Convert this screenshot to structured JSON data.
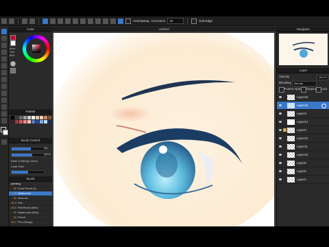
{
  "toolbar": {
    "antialiasing_label": "AntiAliasing",
    "correction_label": "Correction",
    "correction_value": "10",
    "soft_edge_label": "Soft Edge"
  },
  "document": {
    "title": "Untitled"
  },
  "color_panel": {
    "title": "Color",
    "mini_labels": [
      "Ambr",
      "Tran",
      "Blnd"
    ]
  },
  "palette": {
    "title": "Palette",
    "colors": [
      "#000000",
      "#3c3c3c",
      "#6e6e6e",
      "#a0a0a0",
      "#d2d2d2",
      "#ffffff",
      "#e9c9b0",
      "#f2d5c4",
      "#c98b6b",
      "#8a4f3b",
      "#3a1f1a",
      "#9c3c3c",
      "#d95757",
      "#e88a8a",
      "#f3c1c1",
      "#5c7ac2",
      "#2e4a8a",
      "#7fb3e6",
      "#bcdcf5",
      "#1d2f55"
    ]
  },
  "brush_control": {
    "title": "Brush Control",
    "size_value": "60",
    "opacity_value": "63 %",
    "ease_label": "Ease of Mixing Colors",
    "load_label": "Load Color",
    "size_fraction": 0.6,
    "opacity_fraction": 0.63
  },
  "brush": {
    "title": "Brush",
    "group_name": "painting",
    "items": [
      {
        "size": "30",
        "name": "Lead Pencil (3)"
      },
      {
        "size": "40",
        "name": "Watercolor"
      },
      {
        "size": "30",
        "name": "Airbrush"
      },
      {
        "size": "25.0",
        "name": "Pen"
      },
      {
        "size": "25.0",
        "name": "Flat Brush (Wet)"
      },
      {
        "size": "50",
        "name": "Watercolor (Wet)"
      },
      {
        "size": "20",
        "name": "Pencil"
      },
      {
        "size": "46.7",
        "name": "Pen (Sharp)"
      }
    ]
  },
  "navigator": {
    "title": "Navigator"
  },
  "layer_panel": {
    "title": "Layer",
    "opacity_label": "Opacity",
    "opacity_value": "100 %",
    "blending_label": "Blending",
    "blending_value": "Normal",
    "protect_alpha_label": "Protect Alpha",
    "clipping_label": "Clipping",
    "lock_label": "Lock",
    "layers": [
      "Layer16",
      "Layer15",
      "Layer3",
      "Layer14",
      "Layer4",
      "Layer12",
      "Layer11",
      "Layer10",
      "Layer9",
      "Layer5",
      "Layer1"
    ]
  }
}
